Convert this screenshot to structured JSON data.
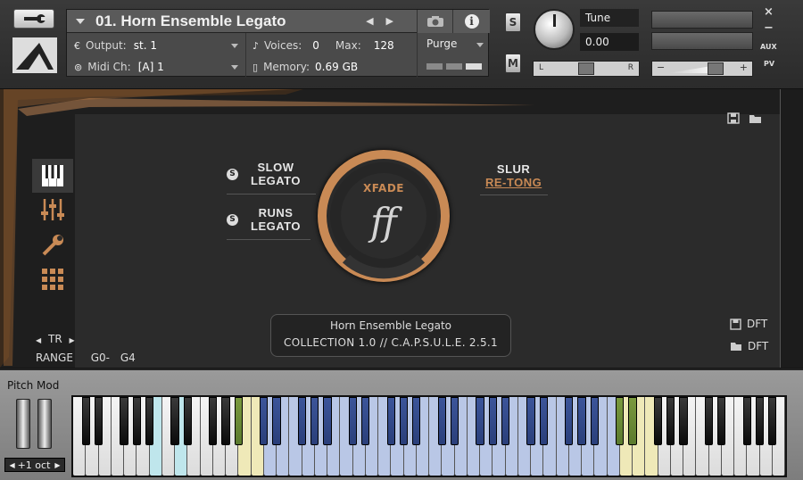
{
  "header": {
    "instrument_name": "01. Horn Ensemble Legato",
    "output_label": "Output:",
    "output_value": "st. 1",
    "midi_label": "Midi Ch:",
    "midi_value": "[A]  1",
    "voices_label": "Voices:",
    "voices_value": "0",
    "max_label": "Max:",
    "max_value": "128",
    "memory_label": "Memory:",
    "memory_value": "0.69 GB",
    "purge_label": "Purge",
    "solo_label": "S",
    "mute_label": "M",
    "tune_label": "Tune",
    "tune_value": "0.00",
    "pan_left": "L",
    "pan_right": "R",
    "vol_minus": "−",
    "vol_plus": "+",
    "aux_label": "AUX",
    "pv_label": "PV",
    "close_label": "×",
    "minimize_label": "−"
  },
  "articulations": {
    "left_top": [
      "SLOW",
      "LEGATO"
    ],
    "left_bottom": [
      "RUNS",
      "LEGATO"
    ],
    "right_line1": "SLUR",
    "right_line2": "RE-TONG",
    "s_badge": "S"
  },
  "dial": {
    "label": "XFADE",
    "dynamic": "ff"
  },
  "info_plate": {
    "line1": "Horn Ensemble Legato",
    "line2": "COLLECTION 1.0  //  C.A.P.S.U.L.E. 2.5.1"
  },
  "transpose": {
    "label": "TR",
    "range_label": "RANGE",
    "range_low": "G0-",
    "range_high": "G4"
  },
  "presets": {
    "save_label": "DFT",
    "load_label": "DFT"
  },
  "keyboard": {
    "pitch_mod_label": "Pitch Mod",
    "octave_label": "+1 oct",
    "colors": {
      "cyan": "#bfe6ec",
      "yellow": "#efe9b8",
      "blue": "#b9c7e6",
      "black_green": "#5b7a2e",
      "black_blue": "#2a3f7a"
    }
  }
}
